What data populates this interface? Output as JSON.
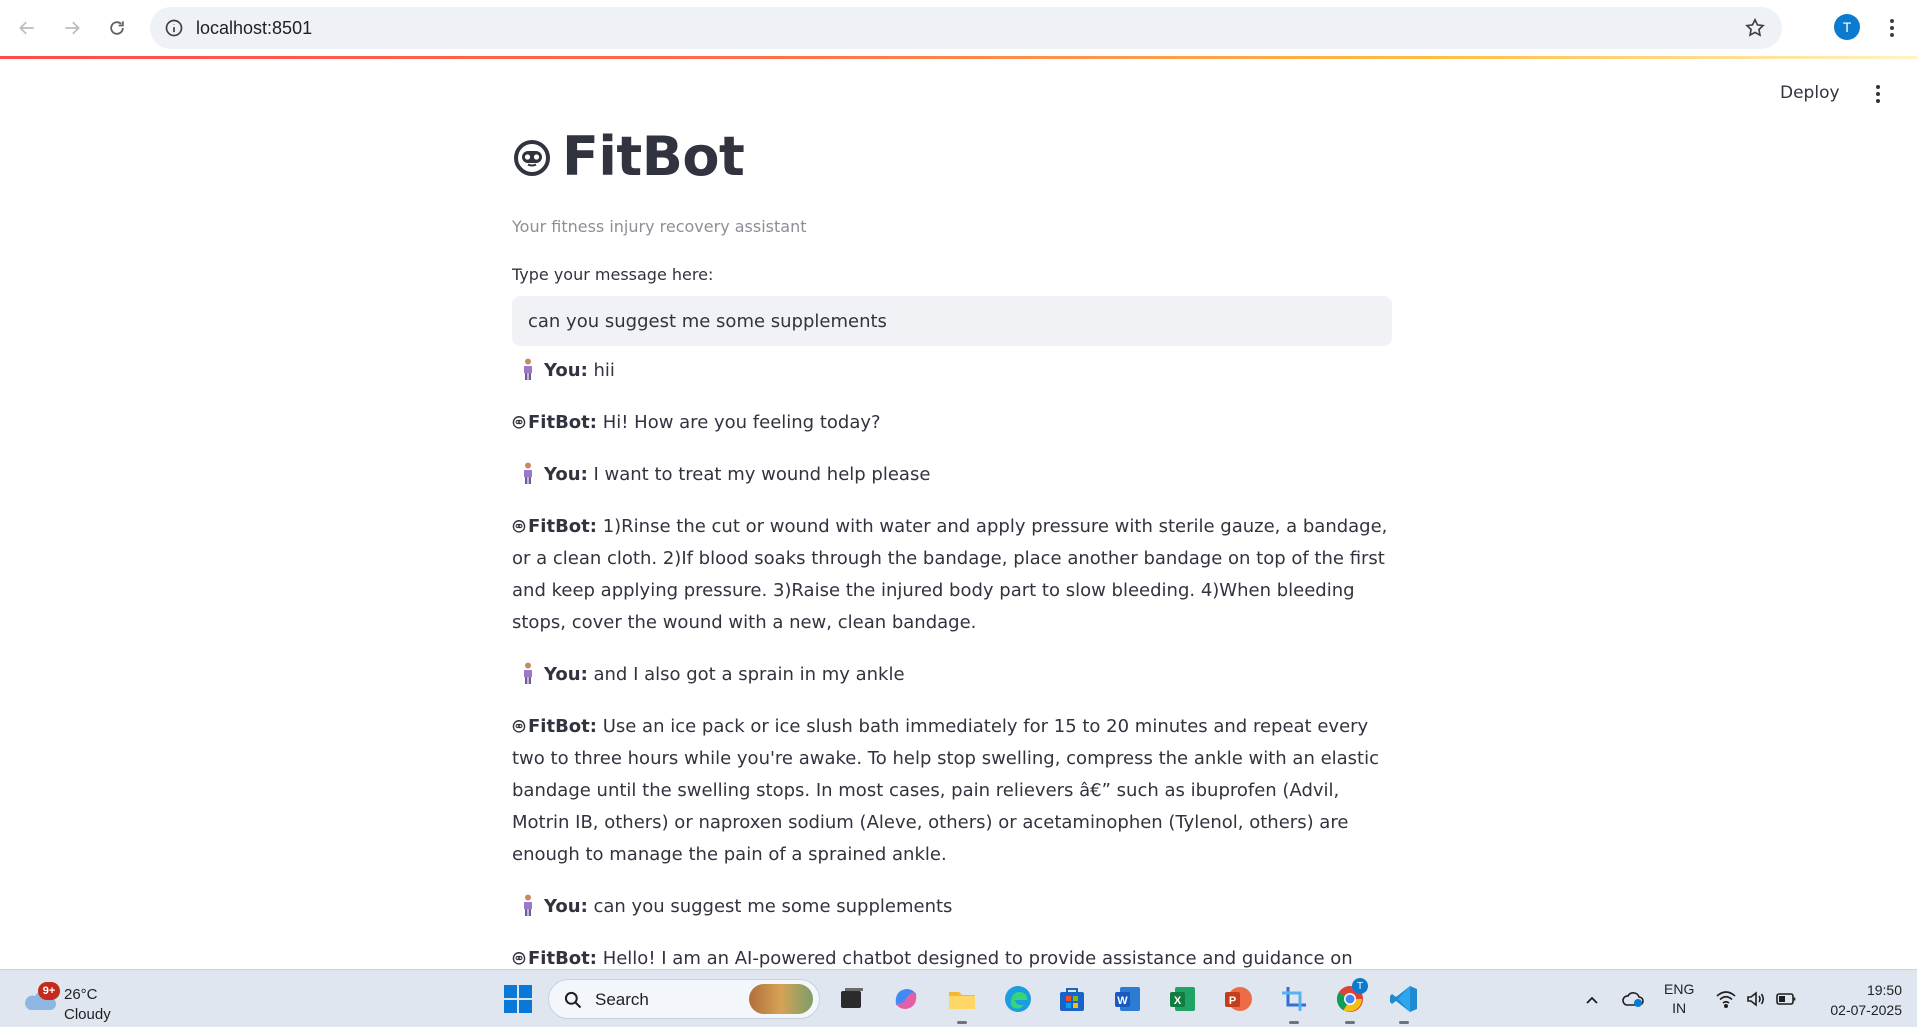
{
  "browser": {
    "url": "localhost:8501",
    "profile_initial": "T"
  },
  "app": {
    "deploy_label": "Deploy",
    "title": "FitBot",
    "subtitle": "Your fitness injury recovery assistant",
    "input_label": "Type your message here:",
    "input_value": "can you suggest me some supplements"
  },
  "chat": [
    {
      "role": "user",
      "who": "You:",
      "text": " hii"
    },
    {
      "role": "bot",
      "who": "FitBot:",
      "text": " Hi! How are you feeling today?"
    },
    {
      "role": "user",
      "who": "You:",
      "text": " I want to treat my wound help please"
    },
    {
      "role": "bot",
      "who": "FitBot:",
      "text": " 1)Rinse the cut or wound with water and apply pressure with sterile gauze, a bandage, or a clean cloth. 2)If blood soaks through the bandage, place another bandage on top of the first and keep applying pressure. 3)Raise the injured body part to slow bleeding. 4)When bleeding stops, cover the wound with a new, clean bandage."
    },
    {
      "role": "user",
      "who": "You:",
      "text": " and I also got a sprain in my ankle"
    },
    {
      "role": "bot",
      "who": "FitBot:",
      "text": " Use an ice pack or ice slush bath immediately for 15 to 20 minutes and repeat every two to three hours while you're awake. To help stop swelling, compress the ankle with an elastic bandage until the swelling stops. In most cases, pain relievers â€” such as ibuprofen (Advil, Motrin IB, others) or naproxen sodium (Aleve, others) or acetaminophen (Tylenol, others) are enough to manage the pain of a sprained ankle."
    },
    {
      "role": "user",
      "who": "You:",
      "text": " can you suggest me some supplements"
    },
    {
      "role": "bot",
      "who": "FitBot:",
      "text": " Hello! I am an AI-powered chatbot designed to provide assistance and guidance on various"
    }
  ],
  "taskbar": {
    "weather_badge": "9+",
    "temperature": "26°C",
    "condition": "Cloudy",
    "search_label": "Search",
    "lang_top": "ENG",
    "lang_bottom": "IN",
    "time": "19:50",
    "date": "02-07-2025",
    "chrome_badge": "T"
  },
  "colors": {
    "accent_gradient_start": "#ff4b4b",
    "accent_gradient_end": "#ffbd45",
    "text_primary": "#31333f",
    "input_bg": "#f0f2f6",
    "profile_blue": "#0b7ad1"
  }
}
